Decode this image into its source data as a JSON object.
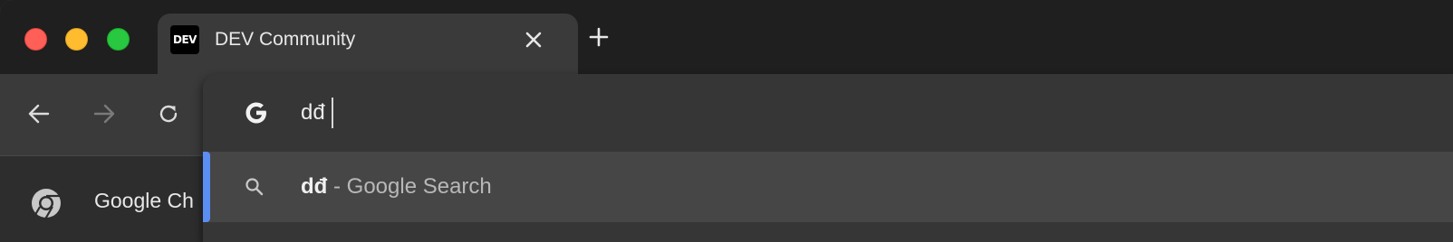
{
  "tab": {
    "favicon_text": "DEV",
    "title": "DEV Community"
  },
  "omnibox": {
    "text": "dđ"
  },
  "suggestion": {
    "query": "dđ",
    "suffix": " - Google Search"
  },
  "bookmarks": {
    "first_label": "Google Ch"
  },
  "icons": {
    "close": "close-icon",
    "new_tab": "plus-icon",
    "back": "arrow-left-icon",
    "forward": "arrow-right-icon",
    "reload": "reload-icon",
    "search_engine": "google-g-icon",
    "suggestion": "search-icon",
    "bookmark": "chrome-icon"
  },
  "colors": {
    "accent": "#5b8ef2",
    "close_light": "#fe5f57",
    "minimize_light": "#febc2e",
    "zoom_light": "#28c840"
  }
}
